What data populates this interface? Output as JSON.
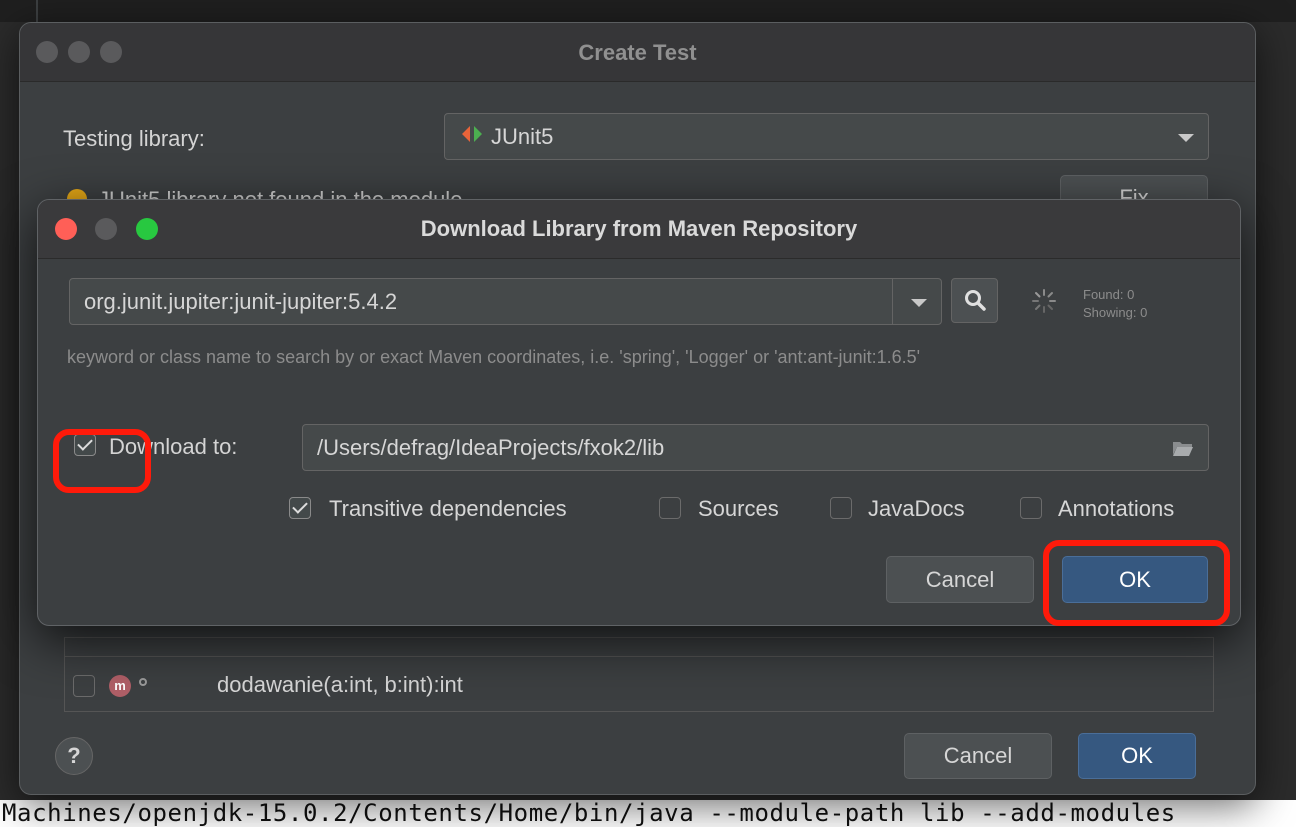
{
  "background": {
    "terminal_text": "Machines/openjdk-15.0.2/Contents/Home/bin/java --module-path lib --add-modules"
  },
  "create_test": {
    "title": "Create Test",
    "testing_library_label": "Testing library:",
    "testing_library_value": "JUnit5",
    "warning_text": "JUnit5 library not found in the module",
    "fix_label": "Fix",
    "method_row": {
      "badge": "m",
      "signature": "dodawanie(a:int, b:int):int"
    },
    "help_label": "?",
    "cancel_label": "Cancel",
    "ok_label": "OK"
  },
  "download_dialog": {
    "title": "Download Library from Maven Repository",
    "search_value": "org.junit.jupiter:junit-jupiter:5.4.2",
    "found_label": "Found: 0",
    "showing_label": "Showing: 0",
    "hint": "keyword or class name to search by or exact Maven coordinates, i.e. 'spring', 'Logger' or 'ant:ant-junit:1.6.5'",
    "download_to_label": "Download to:",
    "download_to_checked": true,
    "download_path": "/Users/defrag/IdeaProjects/fxok2/lib",
    "options": [
      {
        "label": "Transitive dependencies",
        "checked": true
      },
      {
        "label": "Sources",
        "checked": false
      },
      {
        "label": "JavaDocs",
        "checked": false
      },
      {
        "label": "Annotations",
        "checked": false
      }
    ],
    "cancel_label": "Cancel",
    "ok_label": "OK"
  },
  "colors": {
    "annotation_red": "#ff1a0a",
    "primary_button": "#365880"
  }
}
